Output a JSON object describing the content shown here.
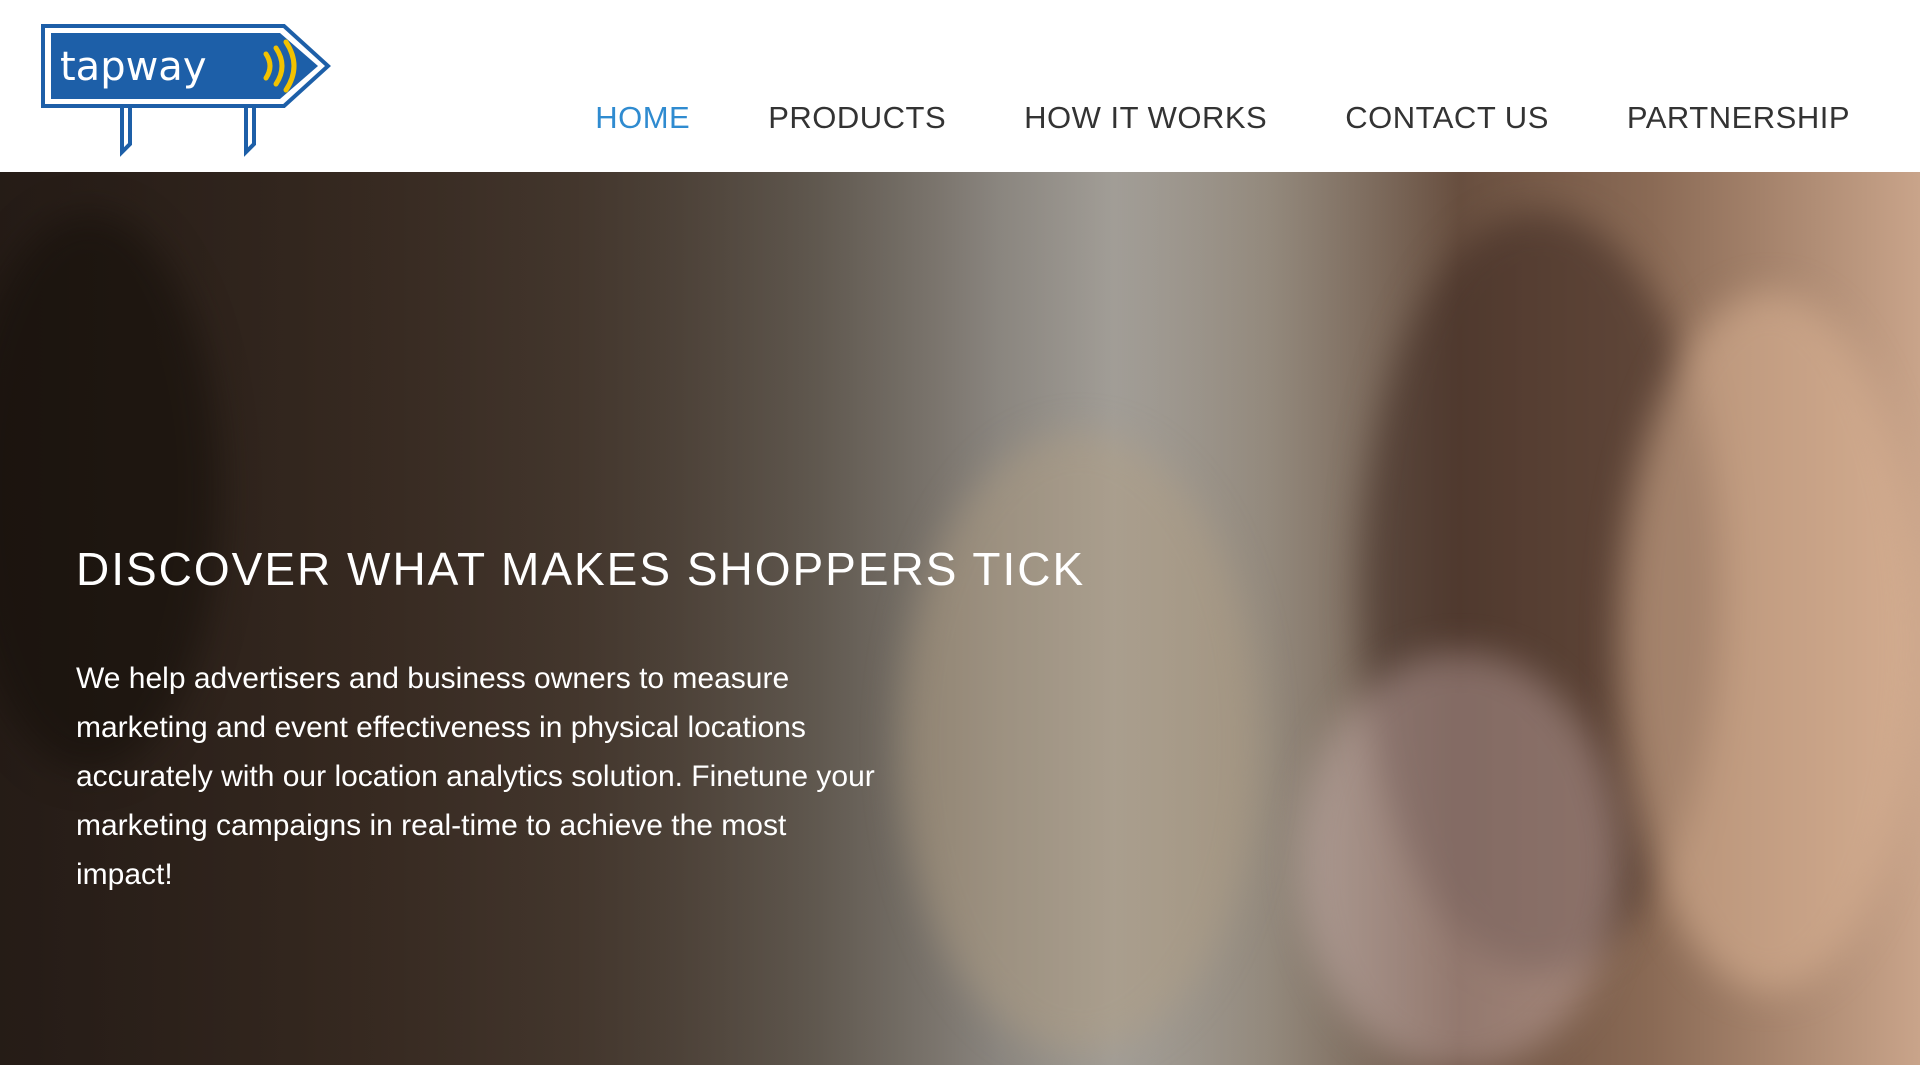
{
  "brand": {
    "name": "tapway",
    "logo_colors": {
      "sign_fill": "#1d5fa8",
      "outline": "#1d5fa8",
      "text": "#ffffff",
      "waves": "#f2c200"
    }
  },
  "nav": {
    "items": [
      {
        "label": "HOME",
        "active": true
      },
      {
        "label": "PRODUCTS",
        "active": false
      },
      {
        "label": "HOW IT WORKS",
        "active": false
      },
      {
        "label": "CONTACT US",
        "active": false
      },
      {
        "label": "PARTNERSHIP",
        "active": false
      }
    ],
    "active_color": "#2f8bd0",
    "text_color": "#333333"
  },
  "hero": {
    "title": "DISCOVER WHAT MAKES SHOPPERS TICK",
    "body": "We help advertisers and business owners to measure marketing and event effectiveness in physical locations accurately with our location analytics solution. Finetune your marketing campaigns in real-time to achieve the most impact!",
    "background_image": "photo of smiling shoppers in a shop"
  }
}
